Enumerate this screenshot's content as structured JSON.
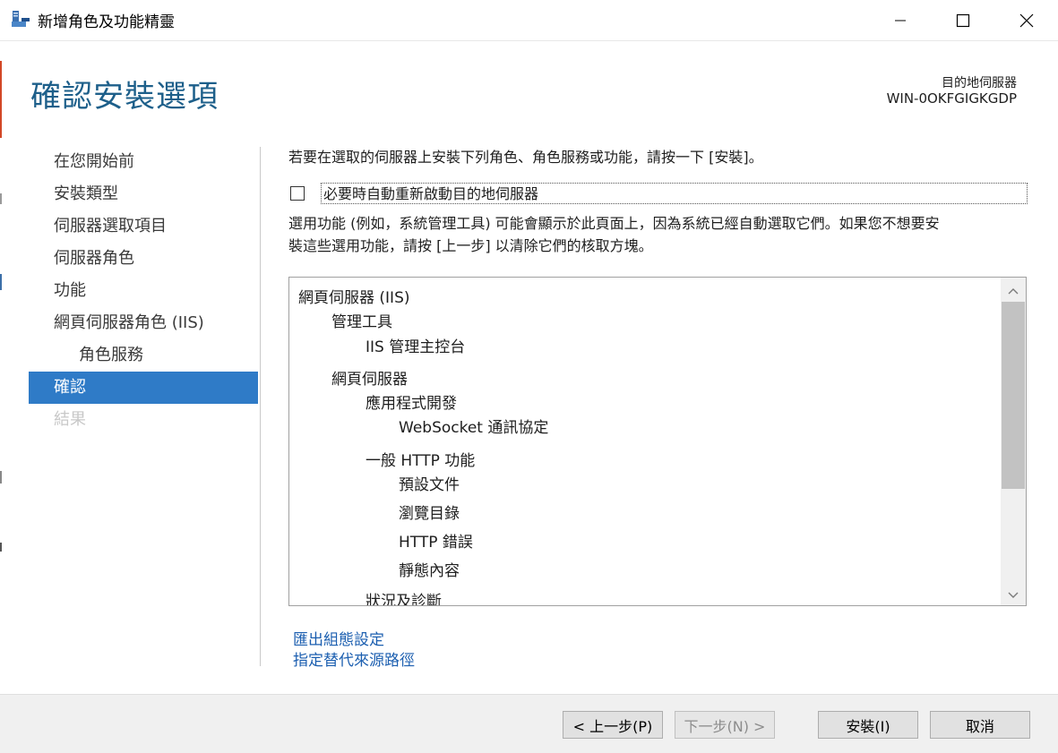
{
  "window": {
    "title": "新增角色及功能精靈",
    "controls": [
      "minimize-icon",
      "maximize-icon",
      "close-icon"
    ]
  },
  "header": {
    "page_title": "確認安裝選項",
    "destination_label": "目的地伺服器",
    "destination_value": "WIN-0OKFGIGKGDP"
  },
  "nav": {
    "items": [
      {
        "label": "在您開始前",
        "state": "normal"
      },
      {
        "label": "安裝類型",
        "state": "normal"
      },
      {
        "label": "伺服器選取項目",
        "state": "normal"
      },
      {
        "label": "伺服器角色",
        "state": "normal"
      },
      {
        "label": "功能",
        "state": "normal"
      },
      {
        "label": "網頁伺服器角色 (IIS)",
        "state": "normal"
      },
      {
        "label": "角色服務",
        "state": "sub"
      },
      {
        "label": "確認",
        "state": "active"
      },
      {
        "label": "結果",
        "state": "disabled"
      }
    ]
  },
  "main": {
    "intro": "若要在選取的伺服器上安裝下列角色、角色服務或功能，請按一下 [安裝]。",
    "restart_label": "必要時自動重新啟動目的地伺服器",
    "restart_checked": false,
    "note_line1": "選用功能 (例如，系統管理工具) 可能會顯示於此頁面上，因為系統已經自動選取它們。如果您不想要安",
    "note_line2": "裝這些選用功能，請按 [上一步] 以清除它們的核取方塊。",
    "tree": [
      {
        "label": "網頁伺服器 (IIS)",
        "level": 0
      },
      {
        "label": "管理工具",
        "level": 1
      },
      {
        "label": "IIS 管理主控台",
        "level": 2
      },
      {
        "label": "網頁伺服器",
        "level": 1
      },
      {
        "label": "應用程式開發",
        "level": 2
      },
      {
        "label": "WebSocket 通訊協定",
        "level": 3
      },
      {
        "label": "一般 HTTP 功能",
        "level": 2
      },
      {
        "label": "預設文件",
        "level": 3
      },
      {
        "label": "瀏覽目錄",
        "level": 3
      },
      {
        "label": "HTTP 錯誤",
        "level": 3
      },
      {
        "label": "靜態內容",
        "level": 3
      },
      {
        "label": "狀況及診斷",
        "level": 2
      }
    ],
    "links": {
      "export": "匯出組態設定",
      "alt_source": "指定替代來源路徑"
    }
  },
  "footer": {
    "prev": "< 上一步(P)",
    "next": "下一步(N) >",
    "install": "安裝(I)",
    "cancel": "取消"
  },
  "colors": {
    "title_blue": "#1d5f8a",
    "active_nav": "#2f7bc7",
    "link": "#1c5fb0"
  }
}
